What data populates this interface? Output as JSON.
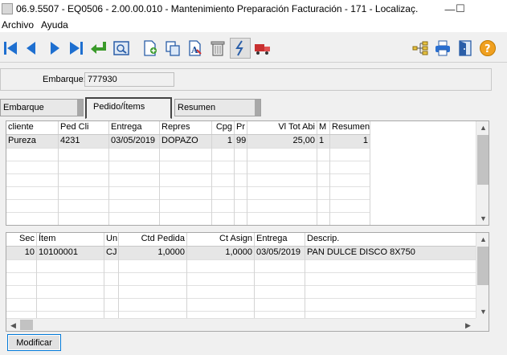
{
  "window": {
    "title": "06.9.5507 - EQ0506 - 2.00.00.010 - Mantenimiento Preparación Facturación - 171 - Localizaç...",
    "minimize_glyph": "—",
    "maximize_glyph": "☐"
  },
  "menu": {
    "items": [
      "Archivo",
      "Ayuda"
    ]
  },
  "toolbar": {
    "buttons": [
      "first-icon",
      "previous-icon",
      "next-icon",
      "last-icon",
      "goto-icon",
      "zoom-icon",
      "new-icon",
      "copy-icon",
      "edit-icon",
      "delete-icon",
      "process-icon",
      "truck-icon",
      "tree-icon",
      "print-icon",
      "exit-icon",
      "help-icon"
    ]
  },
  "embarque": {
    "label": "Embarque:",
    "value": "777930"
  },
  "tabs": [
    "Embarque",
    "Pedido/Ítems",
    "Resumen"
  ],
  "active_tab": "Pedido/Ítems",
  "pedidos_grid": {
    "headers": [
      "cliente",
      "Ped Cli",
      "Entrega",
      "Repres",
      "Cpg",
      "Pr",
      "Vl Tot Abi",
      "M",
      "Resumen"
    ],
    "rows": [
      [
        "Pureza",
        "4231",
        "03/05/2019",
        "DOPAZO",
        "1",
        "99",
        "25,00",
        "1",
        "1"
      ]
    ]
  },
  "items_grid": {
    "headers": [
      "Sec",
      "Ítem",
      "Un",
      "Ctd Pedida",
      "Ct Asign",
      "Entrega",
      "Descrip."
    ],
    "rows": [
      [
        "10",
        "10100001",
        "CJ",
        "1,0000",
        "1,0000",
        "03/05/2019",
        "PAN DULCE DISCO 8X750"
      ]
    ]
  },
  "actions": {
    "modificar_label": "Modificar"
  },
  "colors": {
    "background": "#f0f0f0",
    "grid_background": "#ffffff",
    "selection": "#e6e6e6",
    "focus_border": "#0078d7"
  }
}
